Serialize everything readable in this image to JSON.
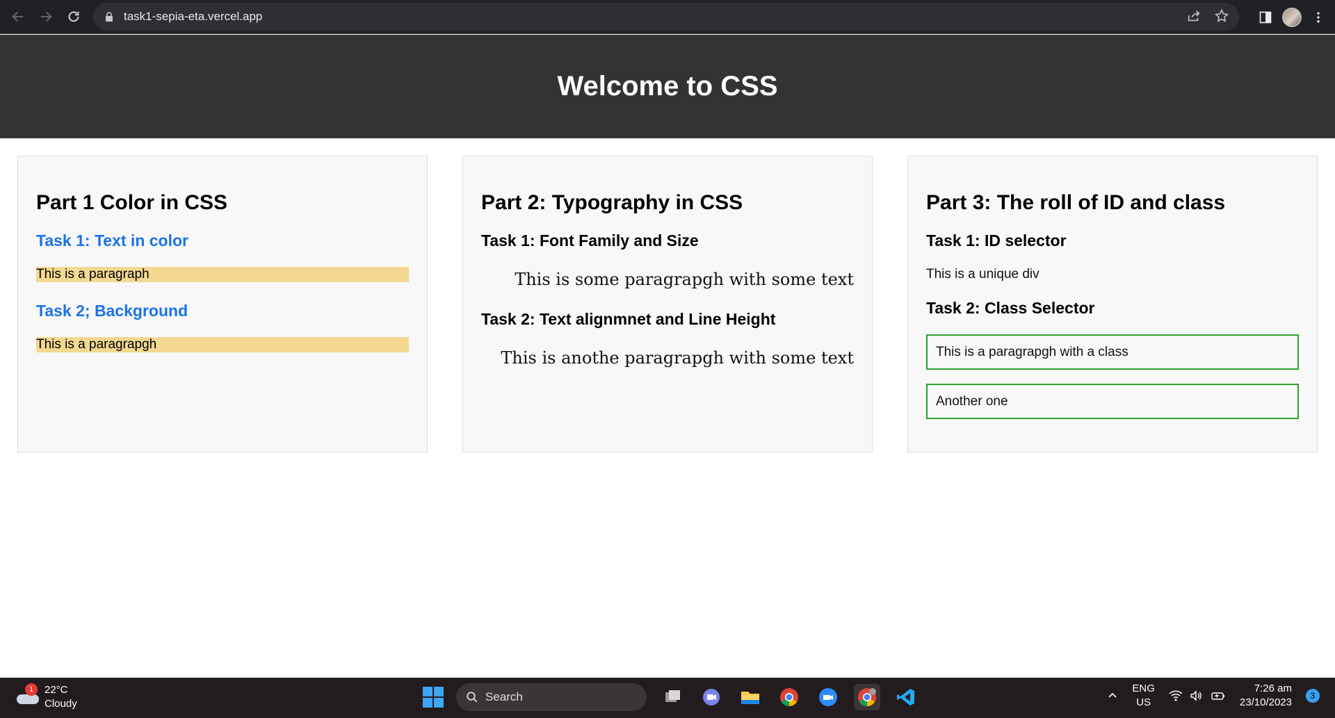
{
  "browser": {
    "url": "task1-sepia-eta.vercel.app"
  },
  "header": {
    "title": "Welcome to CSS"
  },
  "cards": [
    {
      "title": "Part 1 Color in CSS",
      "task1": "Task 1: Text in color",
      "para1": "This is a paragraph",
      "task2": "Task 2; Background",
      "para2": "This is a paragrapgh"
    },
    {
      "title": "Part 2: Typography in CSS",
      "task1": "Task 1: Font Family and Size",
      "para1": "This is some paragrapgh with some text",
      "task2": "Task 2: Text alignmnet and Line Height",
      "para2": "This is anothe paragrapgh with some text"
    },
    {
      "title": "Part 3: The roll of ID and class",
      "task1": "Task 1: ID selector",
      "para1": "This is a unique div",
      "task2": "Task 2: Class Selector",
      "box1": "This is a paragrapgh with a class",
      "box2": "Another one"
    }
  ],
  "taskbar": {
    "weather_temp": "22°C",
    "weather_desc": "Cloudy",
    "weather_badge": "1",
    "search_label": "Search",
    "lang_top": "ENG",
    "lang_bottom": "US",
    "time": "7:26 am",
    "date": "23/10/2023",
    "notification_count": "3"
  },
  "colors": {
    "header_bg": "#333333",
    "task_blue": "#1a73e8",
    "highlight": "#f2d891",
    "class_border": "#2ca02c"
  }
}
